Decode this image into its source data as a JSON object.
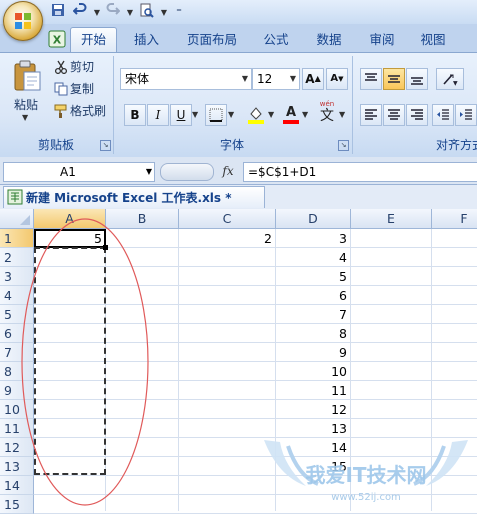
{
  "tabs": [
    "开始",
    "插入",
    "页面布局",
    "公式",
    "数据",
    "审阅",
    "视图"
  ],
  "clipboard": {
    "paste": "粘贴",
    "cut": "剪切",
    "copy": "复制",
    "format_painter": "格式刷",
    "group_label": "剪贴板"
  },
  "font": {
    "name": "宋体",
    "size": "12",
    "bold": "B",
    "italic": "I",
    "underline": "U",
    "font_color": "A",
    "phonetic": "wén",
    "phonetic_char": "文",
    "grow": "A",
    "shrink": "A",
    "group_label": "字体"
  },
  "alignment": {
    "group_label": "对齐方式"
  },
  "formula_bar": {
    "name_box": "A1",
    "fx": "fx",
    "formula": "=$C$1+D1"
  },
  "document": {
    "title": "新建 Microsoft Excel 工作表.xls *"
  },
  "grid": {
    "columns": [
      "A",
      "B",
      "C",
      "D",
      "E",
      "F"
    ],
    "rows": [
      "1",
      "2",
      "3",
      "4",
      "5",
      "6",
      "7",
      "8",
      "9",
      "10",
      "11",
      "12",
      "13",
      "14",
      "15"
    ],
    "cells": {
      "A1": "5",
      "C1": "2",
      "D": [
        "3",
        "4",
        "5",
        "6",
        "7",
        "8",
        "9",
        "10",
        "11",
        "12",
        "13",
        "14",
        "15"
      ]
    }
  },
  "colors": {
    "accent": "#15428b",
    "ribbon": "#dbe7f7",
    "annotation": "#e05a5a"
  }
}
